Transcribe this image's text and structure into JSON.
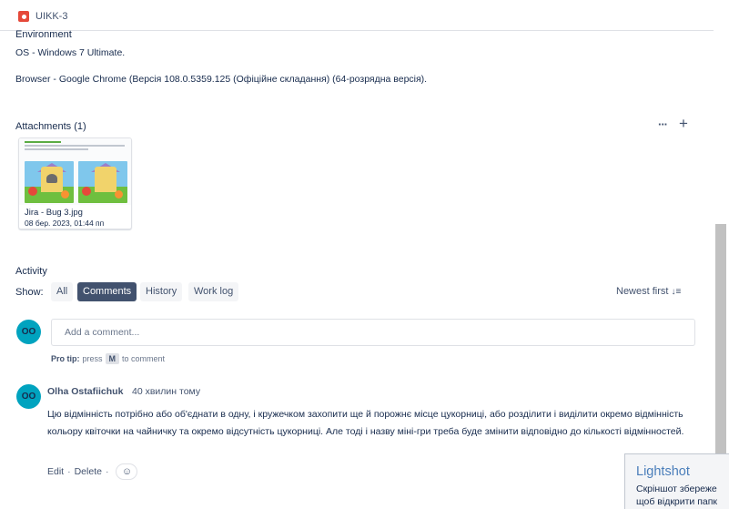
{
  "issue": {
    "key": "UIKK-3"
  },
  "environment": {
    "title": "Environment",
    "os": "OS - Windows 7 Ultimate.",
    "browser": "Browser - Google Chrome (Версія 108.0.5359.125 (Офіційне складання) (64-розрядна версія)."
  },
  "attachments": {
    "title": "Attachments (1)",
    "more_label": "···",
    "add_label": "+",
    "items": [
      {
        "name": "Jira - Bug 3.jpg",
        "date": "08 бер. 2023, 01:44 пп"
      }
    ]
  },
  "activity": {
    "title": "Activity",
    "show_label": "Show:",
    "filters": [
      "All",
      "Comments",
      "History",
      "Work log"
    ],
    "active_filter": "Comments",
    "sort_label": "Newest first"
  },
  "comment_box": {
    "avatar_initials": "OO",
    "placeholder": "Add a comment...",
    "protip_label": "Pro tip:",
    "protip_press": "press",
    "protip_key": "M",
    "protip_suffix": "to comment"
  },
  "comments": [
    {
      "avatar_initials": "OO",
      "author": "Olha Ostafiichuk",
      "time": "40 хвилин тому",
      "body": "Цю відмінність потрібно або об'єднати в одну, і кружечком захопити ще й порожнє місце цукорниці, або розділити і виділити окремо відмінність кольору квіточки на чайничку та окремо відсутність цукорниці. Але тоді і назву міні-гри треба буде змінити відповідно до кількості відмінностей.",
      "edit_label": "Edit",
      "delete_label": "Delete"
    }
  ],
  "lightshot": {
    "title": "Lightshot",
    "line1": "Скріншот збереже",
    "line2": "щоб відкрити папк"
  },
  "colors": {
    "accent": "#42526e",
    "avatar": "#00a3bf",
    "bug": "#e5493a",
    "lightshot": "#4a7eba"
  }
}
